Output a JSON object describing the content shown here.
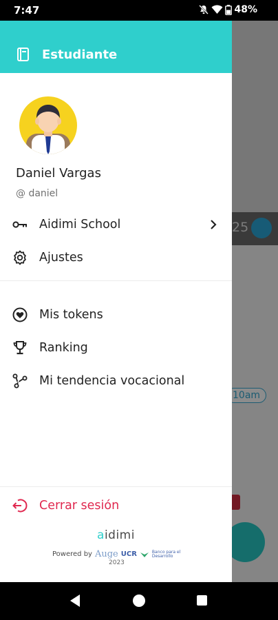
{
  "status_bar": {
    "time": "7:47",
    "battery": "48%",
    "icons": [
      "mute-icon",
      "wifi-icon",
      "battery-icon"
    ]
  },
  "drawer": {
    "header": {
      "title": "Estudiante",
      "icon": "book-icon"
    },
    "profile": {
      "name": "Daniel Vargas",
      "handle": "@ daniel"
    },
    "menu_top": [
      {
        "label": "Aidimi School",
        "icon": "key-icon",
        "has_chevron": true
      },
      {
        "label": "Ajustes",
        "icon": "gear-icon"
      }
    ],
    "menu_main": [
      {
        "label": "Mis tokens",
        "icon": "heart-token-icon"
      },
      {
        "label": "Ranking",
        "icon": "trophy-icon"
      },
      {
        "label": "Mi tendencia vocacional",
        "icon": "share-nodes-icon"
      }
    ],
    "logout": {
      "label": "Cerrar sesión",
      "icon": "logout-icon",
      "color": "#e0284f"
    },
    "footer": {
      "brand_a": "a",
      "brand_rest": "idimi",
      "powered_by": "Powered by",
      "partner_1": "Auge",
      "partner_2": "UCR",
      "partner_3_line1": "Banco para el",
      "partner_3_line2": "Desarrollo",
      "year": "2023"
    }
  },
  "background_app": {
    "number_fragment": "25",
    "time_pill": "10am"
  },
  "colors": {
    "accent": "#2fcfcc",
    "logout": "#e0284f",
    "avatar_bg": "#f6d21f"
  }
}
